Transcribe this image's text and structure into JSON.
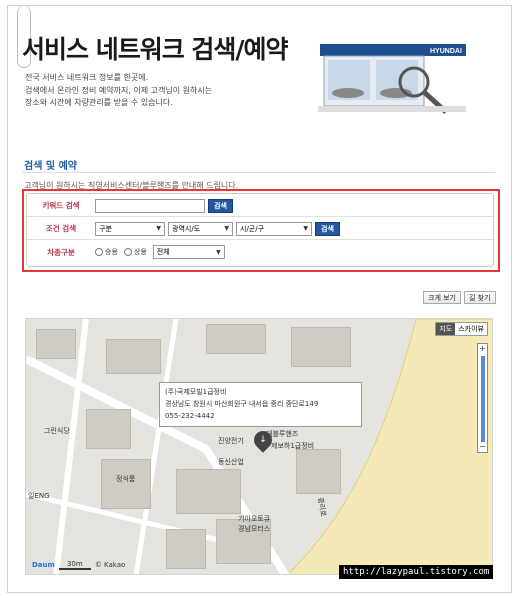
{
  "header": {
    "title": "서비스 네트워크 검색/예약",
    "desc_lines": [
      "전국 서비스 네트워크 정보를 한곳에.",
      "검색에서 온라인 정비 예약까지, 이제 고객님이 원하시는",
      "장소와 시간에 차량관리를 받을 수 있습니다."
    ],
    "brand": "HYUNDAI"
  },
  "search": {
    "title": "검색 및 예약",
    "desc": "고객님이 원하시는 직영서비스센터/블루핸즈를 안내해 드립니다.",
    "keyword_label": "키워드 검색",
    "keyword_value": "",
    "search_btn": "검색",
    "cond_label": "조건 검색",
    "cond_selects": [
      "구분",
      "광역시/도",
      "시/군/구"
    ],
    "cond_btn": "검색",
    "vehicle_label": "차종구분",
    "radio1": "승용",
    "radio2": "상용",
    "vehicle_select": "전체"
  },
  "map_buttons": {
    "larger": "크게 보기",
    "directions": "길 찾기"
  },
  "map": {
    "type_map": "지도",
    "type_sky": "스카이뷰",
    "bubble_name": "(주)국제모빌1급정비",
    "bubble_addr": "경상남도 창원시 마산회원구 내서읍 중리 중단로149",
    "bubble_phone": "055-232-4442",
    "labels": [
      "진양전기",
      "동신산업",
      "그린식당",
      "정식룸",
      "일ENG",
      "기아오토큐",
      "경남모터스",
      "대블루핸즈",
      "제보하1급정비",
      "중리로"
    ],
    "scale": "30m",
    "kakao": "© Kakao",
    "daum": "Daum"
  },
  "watermark": "http://lazypaul.tistory.com"
}
